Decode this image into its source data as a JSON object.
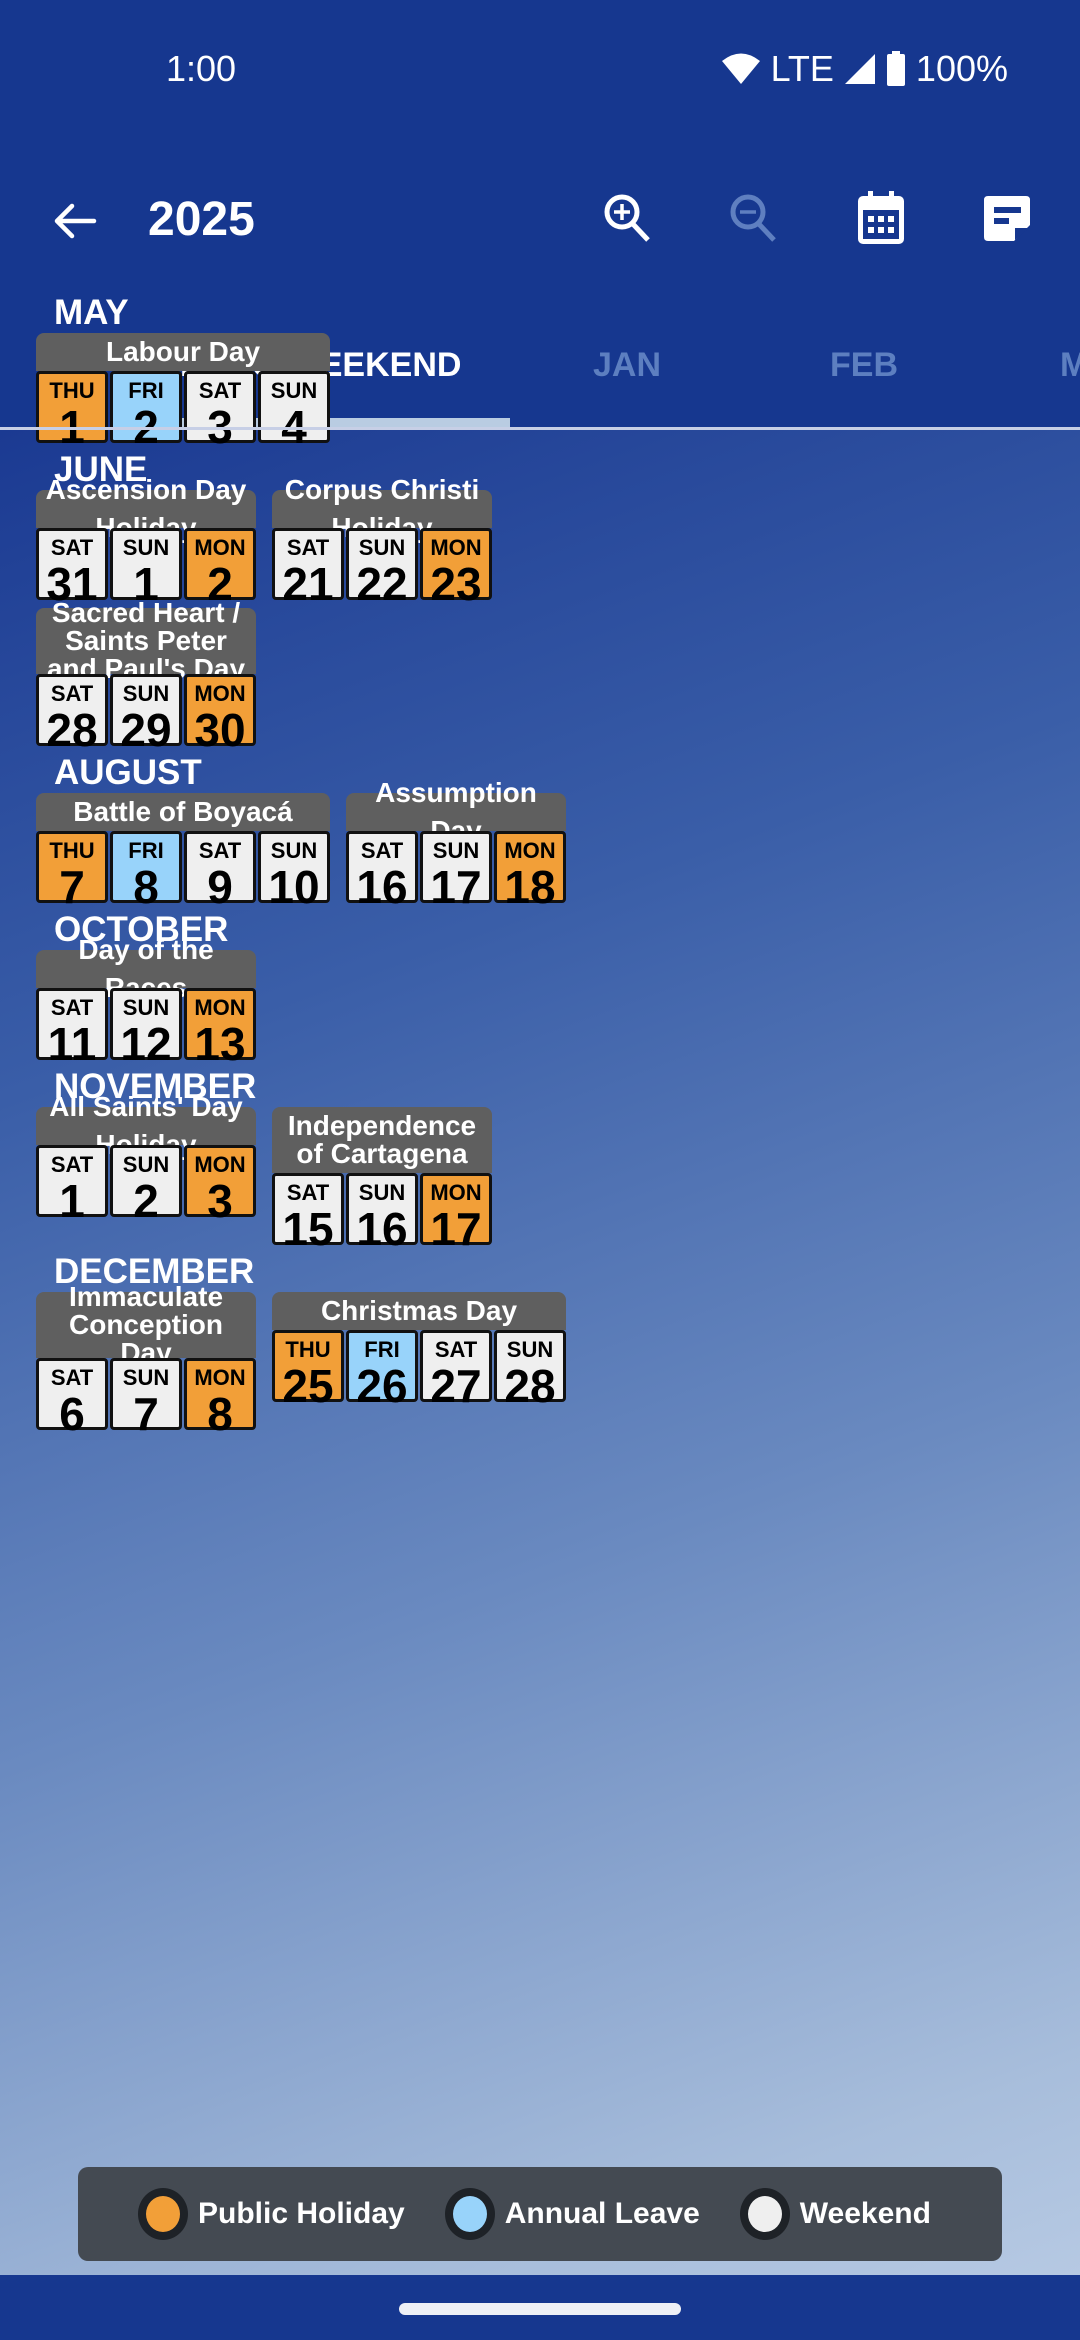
{
  "status_bar": {
    "time": "1:00",
    "network": "LTE",
    "battery": "100%",
    "icons": [
      "wifi-icon",
      "signal-icon",
      "battery-icon"
    ]
  },
  "app_bar": {
    "title": "2025",
    "back_icon": "arrow-back-icon",
    "actions": [
      "zoom-in-icon",
      "zoom-out-icon",
      "calendar-icon",
      "note-icon"
    ]
  },
  "tabs": [
    {
      "label": "LONG WEEKEND",
      "active": true
    },
    {
      "label": "JAN",
      "active": false
    },
    {
      "label": "FEB",
      "active": false
    },
    {
      "label": "M",
      "active": false
    }
  ],
  "colors": {
    "public_holiday": "#f29f38",
    "annual_leave": "#98d3fa",
    "weekend": "#efefef",
    "app_bar": "#16378f",
    "card_header": "#5f5f5f"
  },
  "months": [
    {
      "name": "MAY",
      "breaks": [
        {
          "title": "Labour Day",
          "days": [
            {
              "dow": "THU",
              "day": "1",
              "type": "holiday"
            },
            {
              "dow": "FRI",
              "day": "2",
              "type": "leave"
            },
            {
              "dow": "SAT",
              "day": "3",
              "type": "weekend"
            },
            {
              "dow": "SUN",
              "day": "4",
              "type": "weekend"
            }
          ]
        }
      ]
    },
    {
      "name": "JUNE",
      "breaks": [
        {
          "title": "Ascension Day Holiday",
          "days": [
            {
              "dow": "SAT",
              "day": "31",
              "type": "weekend"
            },
            {
              "dow": "SUN",
              "day": "1",
              "type": "weekend"
            },
            {
              "dow": "MON",
              "day": "2",
              "type": "holiday"
            }
          ]
        },
        {
          "title": "Corpus Christi Holiday",
          "days": [
            {
              "dow": "SAT",
              "day": "21",
              "type": "weekend"
            },
            {
              "dow": "SUN",
              "day": "22",
              "type": "weekend"
            },
            {
              "dow": "MON",
              "day": "23",
              "type": "holiday"
            }
          ]
        },
        {
          "title": "Sacred Heart / Saints Peter and Paul's Day",
          "days": [
            {
              "dow": "SAT",
              "day": "28",
              "type": "weekend"
            },
            {
              "dow": "SUN",
              "day": "29",
              "type": "weekend"
            },
            {
              "dow": "MON",
              "day": "30",
              "type": "holiday"
            }
          ]
        }
      ]
    },
    {
      "name": "AUGUST",
      "breaks": [
        {
          "title": "Battle of Boyacá",
          "days": [
            {
              "dow": "THU",
              "day": "7",
              "type": "holiday"
            },
            {
              "dow": "FRI",
              "day": "8",
              "type": "leave"
            },
            {
              "dow": "SAT",
              "day": "9",
              "type": "weekend"
            },
            {
              "dow": "SUN",
              "day": "10",
              "type": "weekend"
            }
          ]
        },
        {
          "title": "Assumption Day",
          "days": [
            {
              "dow": "SAT",
              "day": "16",
              "type": "weekend"
            },
            {
              "dow": "SUN",
              "day": "17",
              "type": "weekend"
            },
            {
              "dow": "MON",
              "day": "18",
              "type": "holiday"
            }
          ]
        }
      ]
    },
    {
      "name": "OCTOBER",
      "breaks": [
        {
          "title": "Day of the Races",
          "days": [
            {
              "dow": "SAT",
              "day": "11",
              "type": "weekend"
            },
            {
              "dow": "SUN",
              "day": "12",
              "type": "weekend"
            },
            {
              "dow": "MON",
              "day": "13",
              "type": "holiday"
            }
          ]
        }
      ]
    },
    {
      "name": "NOVEMBER",
      "breaks": [
        {
          "title": "All Saints' Day Holiday",
          "days": [
            {
              "dow": "SAT",
              "day": "1",
              "type": "weekend"
            },
            {
              "dow": "SUN",
              "day": "2",
              "type": "weekend"
            },
            {
              "dow": "MON",
              "day": "3",
              "type": "holiday"
            }
          ]
        },
        {
          "title": "Independence of Cartagena",
          "days": [
            {
              "dow": "SAT",
              "day": "15",
              "type": "weekend"
            },
            {
              "dow": "SUN",
              "day": "16",
              "type": "weekend"
            },
            {
              "dow": "MON",
              "day": "17",
              "type": "holiday"
            }
          ]
        }
      ]
    },
    {
      "name": "DECEMBER",
      "breaks": [
        {
          "title": "Immaculate Conception Day",
          "days": [
            {
              "dow": "SAT",
              "day": "6",
              "type": "weekend"
            },
            {
              "dow": "SUN",
              "day": "7",
              "type": "weekend"
            },
            {
              "dow": "MON",
              "day": "8",
              "type": "holiday"
            }
          ]
        },
        {
          "title": "Christmas Day",
          "days": [
            {
              "dow": "THU",
              "day": "25",
              "type": "holiday"
            },
            {
              "dow": "FRI",
              "day": "26",
              "type": "leave"
            },
            {
              "dow": "SAT",
              "day": "27",
              "type": "weekend"
            },
            {
              "dow": "SUN",
              "day": "28",
              "type": "weekend"
            }
          ]
        }
      ]
    }
  ],
  "legend": [
    {
      "label": "Public Holiday",
      "type": "holiday"
    },
    {
      "label": "Annual Leave",
      "type": "leave"
    },
    {
      "label": "Weekend",
      "type": "weekend"
    }
  ]
}
